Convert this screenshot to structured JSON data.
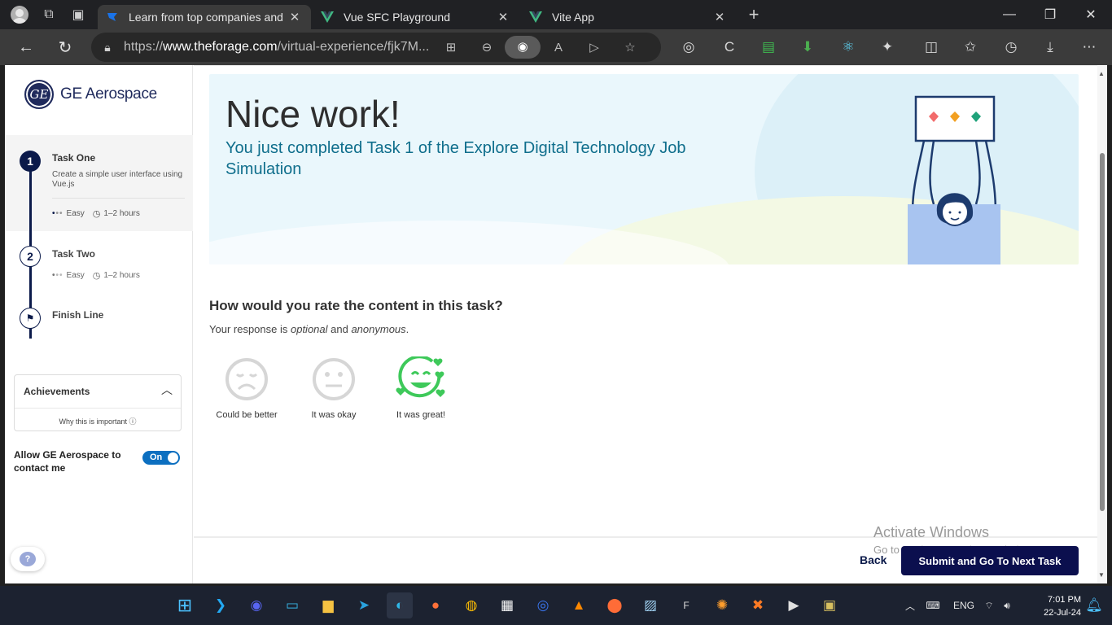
{
  "browser": {
    "tabs": [
      {
        "title": "Learn from top companies and sp",
        "active": true
      },
      {
        "title": "Vue SFC Playground",
        "active": false
      },
      {
        "title": "Vite App",
        "active": false
      }
    ],
    "url_prefix": "https://",
    "url_host": "www.theforage.com",
    "url_path": "/virtual-experience/fjk7M..."
  },
  "sidebar": {
    "brand": "GE Aerospace",
    "logo_glyph": "GE",
    "tasks": [
      {
        "num": "1",
        "title": "Task One",
        "desc": "Create a simple user interface using Vue.js",
        "difficulty": "Easy",
        "duration": "1–2 hours"
      },
      {
        "num": "2",
        "title": "Task Two",
        "difficulty": "Easy",
        "duration": "1–2 hours"
      }
    ],
    "finish": "Finish Line",
    "achievements": {
      "title": "Achievements",
      "why": "Why this is important"
    },
    "allow_contact": "Allow GE Aerospace to contact me",
    "toggle": "On",
    "help": "?"
  },
  "banner": {
    "heading": "Nice work!",
    "subtitle": "You just completed Task 1 of the Explore Digital Technology Job Simulation"
  },
  "rating": {
    "question": "How would you rate the content in this task?",
    "note_prefix": "Your response is ",
    "note_optional": "optional",
    "note_and": " and ",
    "note_anonymous": "anonymous",
    "note_suffix": ".",
    "options": [
      "Could be better",
      "It was okay",
      "It was great!"
    ]
  },
  "footer": {
    "back": "Back",
    "submit": "Submit and Go To Next Task"
  },
  "watermark": {
    "line1": "Activate Windows",
    "line2": "Go to Settings to activate Windows."
  },
  "taskbar": {
    "lang": "ENG",
    "time": "7:01 PM",
    "date": "22-Jul-24"
  },
  "colors": {
    "navy": "#0b0f4e",
    "teal_text": "#0f6e8c",
    "green": "#3ec95a",
    "toggle_blue": "#0c6fc0"
  }
}
